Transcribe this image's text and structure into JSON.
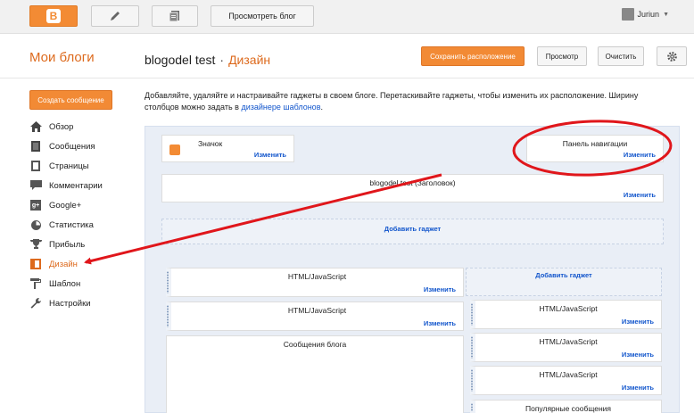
{
  "topbar": {
    "view_blog": "Просмотреть блог",
    "user_name": "Juriun"
  },
  "header": {
    "my_blogs": "Мои блоги",
    "blog_name": "blogodel test",
    "separator": "·",
    "section": "Дизайн",
    "save_layout": "Сохранить расположение",
    "preview": "Просмотр",
    "clear": "Очистить"
  },
  "sidebar": {
    "create_post": "Создать сообщение",
    "items": [
      {
        "label": "Обзор",
        "icon": "home-icon"
      },
      {
        "label": "Сообщения",
        "icon": "posts-icon"
      },
      {
        "label": "Страницы",
        "icon": "pages-icon"
      },
      {
        "label": "Комментарии",
        "icon": "comment-icon"
      },
      {
        "label": "Google+",
        "icon": "google-plus-icon"
      },
      {
        "label": "Статистика",
        "icon": "stats-icon"
      },
      {
        "label": "Прибыль",
        "icon": "trophy-icon"
      },
      {
        "label": "Дизайн",
        "icon": "layout-icon"
      },
      {
        "label": "Шаблон",
        "icon": "template-icon"
      },
      {
        "label": "Настройки",
        "icon": "wrench-icon"
      }
    ]
  },
  "description": {
    "text": "Добавляйте, удаляйте и настраивайте гаджеты в своем блоге. Перетаскивайте гаджеты, чтобы изменить их расположение. Ширину столбцов можно задать в ",
    "link": "дизайнере шаблонов",
    "end": "."
  },
  "layout": {
    "edit_label": "Изменить",
    "add_gadget": "Добавить гаджет",
    "favicon": "Значок",
    "navbar": "Панель навигации",
    "header": "blogodel test (Заголовок)",
    "main_gadgets": [
      "HTML/JavaScript",
      "HTML/JavaScript"
    ],
    "blog_posts": "Сообщения блога",
    "side_gadgets": [
      "HTML/JavaScript",
      "HTML/JavaScript",
      "HTML/JavaScript"
    ],
    "popular_posts": "Популярные сообщения"
  },
  "colors": {
    "accent": "#f28a35",
    "link": "#1155cc",
    "annotation": "#e0161b"
  }
}
